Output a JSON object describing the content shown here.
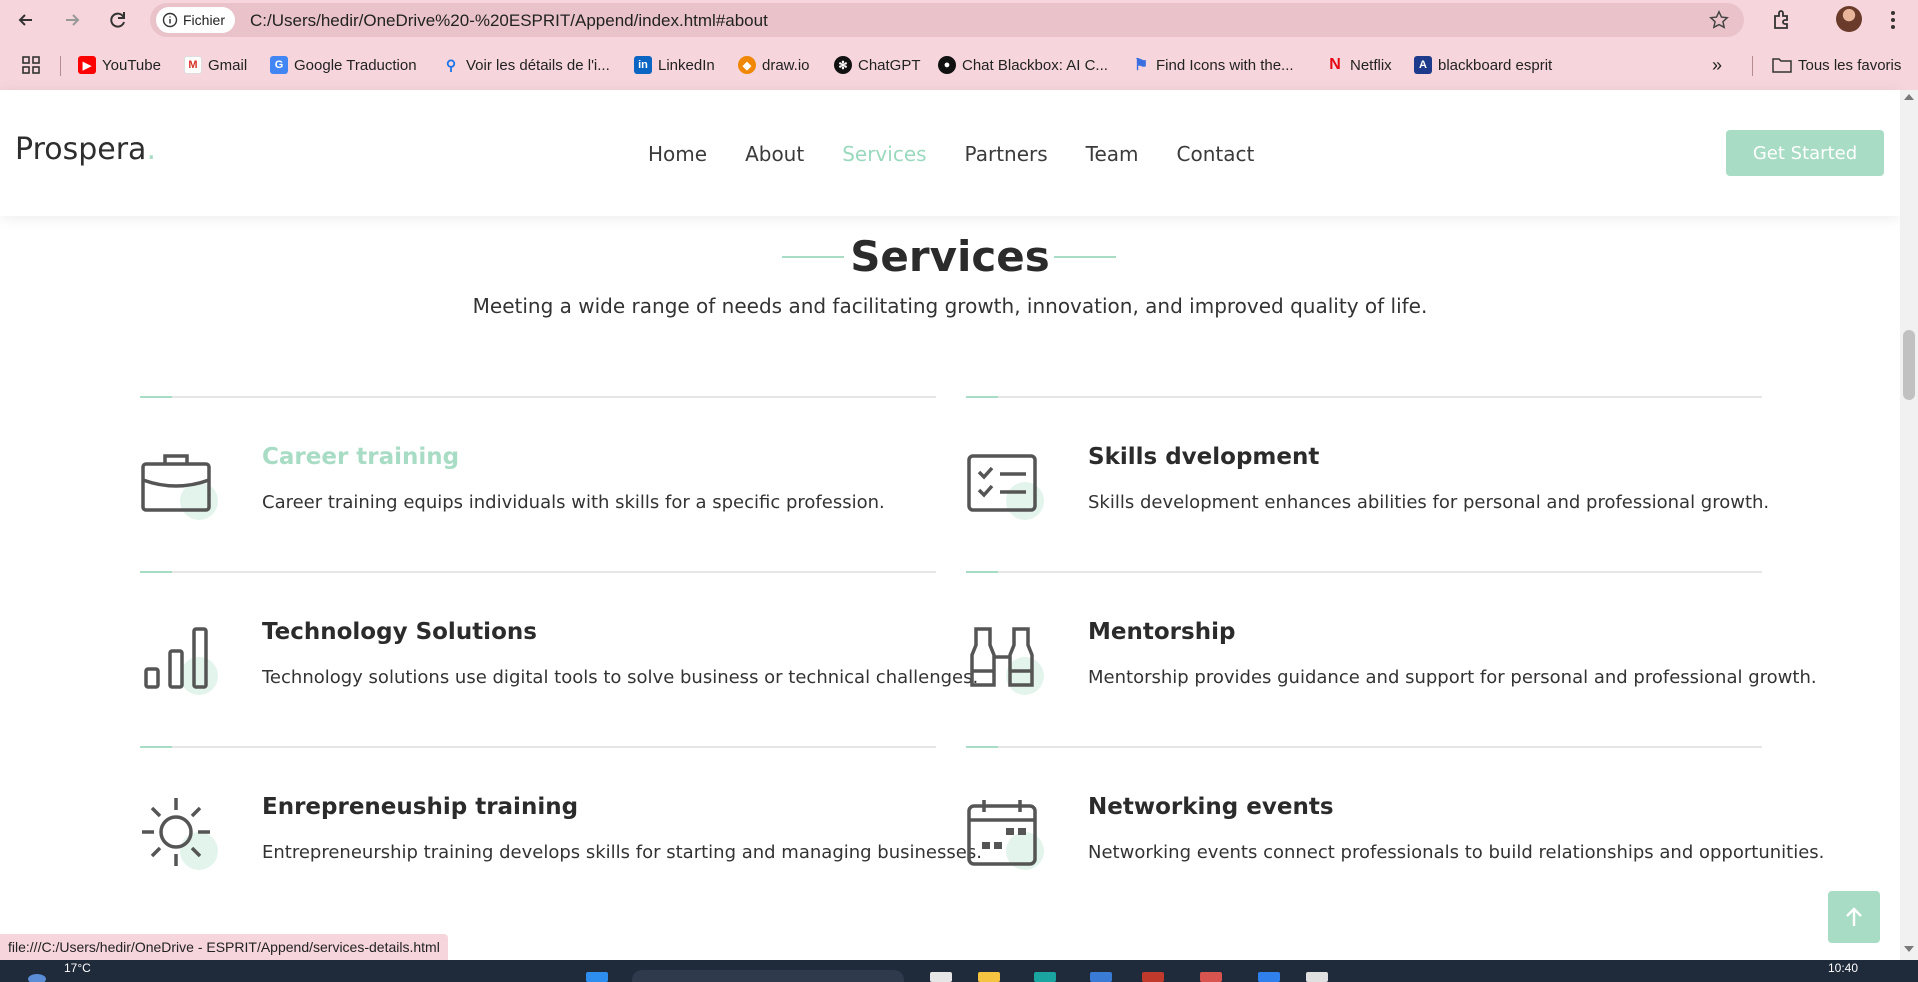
{
  "browser": {
    "url_chip": "Fichier",
    "url": "C:/Users/hedir/OneDrive%20-%20ESPRIT/Append/index.html#about",
    "bookmarks": [
      {
        "label": "YouTube",
        "icon": "youtube-icon"
      },
      {
        "label": "Gmail",
        "icon": "gmail-icon"
      },
      {
        "label": "Google Traduction",
        "icon": "google-translate-icon"
      },
      {
        "label": "Voir les détails de l'i...",
        "icon": "search-icon"
      },
      {
        "label": "LinkedIn",
        "icon": "linkedin-icon"
      },
      {
        "label": "draw.io",
        "icon": "drawio-icon"
      },
      {
        "label": "ChatGPT",
        "icon": "chatgpt-icon"
      },
      {
        "label": "Chat Blackbox: AI C...",
        "icon": "blackbox-icon"
      },
      {
        "label": "Find Icons with the...",
        "icon": "flag-icon"
      },
      {
        "label": "Netflix",
        "icon": "netflix-icon"
      },
      {
        "label": "blackboard esprit",
        "icon": "blackboard-icon"
      }
    ],
    "more_bookmarks": "»",
    "all_bookmarks": "Tous les favoris",
    "status_url": "file:///C:/Users/hedir/OneDrive - ESPRIT/Append/services-details.html"
  },
  "site": {
    "logo": "Prospera",
    "logo_dot": ".",
    "nav": [
      "Home",
      "About",
      "Services",
      "Partners",
      "Team",
      "Contact"
    ],
    "active_nav": "Services",
    "cta": "Get Started"
  },
  "services": {
    "title": "Services",
    "subtitle": "Meeting a wide range of needs and facilitating growth, innovation, and improved quality of life.",
    "items": [
      {
        "title": "Career training",
        "desc": "Career training equips individuals with skills for a specific profession.",
        "icon": "briefcase-icon",
        "highlighted": true
      },
      {
        "title": "Skills dvelopment",
        "desc": "Skills development enhances abilities for personal and professional growth.",
        "icon": "checklist-icon",
        "highlighted": false
      },
      {
        "title": "Technology Solutions",
        "desc": "Technology solutions use digital tools to solve business or technical challenges.",
        "icon": "bar-chart-icon",
        "highlighted": false
      },
      {
        "title": "Mentorship",
        "desc": "Mentorship provides guidance and support for personal and professional growth.",
        "icon": "binoculars-icon",
        "highlighted": false
      },
      {
        "title": "Enrepreneuship training",
        "desc": "Entrepreneurship training develops skills for starting and managing businesses.",
        "icon": "sun-icon",
        "highlighted": false
      },
      {
        "title": "Networking events",
        "desc": "Networking events connect professionals to build relationships and opportunities.",
        "icon": "calendar-icon",
        "highlighted": false
      }
    ]
  },
  "taskbar": {
    "temperature": "17°C",
    "time": "10:40"
  },
  "colors": {
    "accent": "#a8dcc4",
    "chrome": "#f6d6dc",
    "text": "#2b2b2b"
  }
}
